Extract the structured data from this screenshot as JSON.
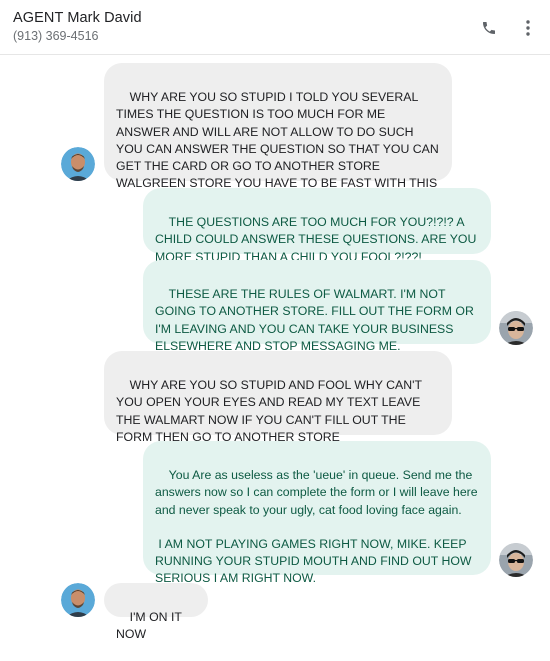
{
  "header": {
    "contact_name": "AGENT Mark David",
    "contact_phone": "(913) 369-4516"
  },
  "icons": {
    "call": "phone-icon",
    "more": "more-vert-icon"
  },
  "colors": {
    "incoming_bubble": "#eeeeee",
    "outgoing_bubble": "#e3f3ef",
    "outgoing_text": "#0d5a43",
    "incoming_text": "#202124"
  },
  "messages": [
    {
      "direction": "incoming",
      "text": "WHY ARE YOU SO STUPID I TOLD YOU SEVERAL TIMES THE QUESTION IS TOO MUCH FOR ME ANSWER AND WILL ARE NOT ALLOW TO DO SUCH YOU CAN ANSWER THE QUESTION SO THAT YOU CAN GET THE CARD OR GO TO ANOTHER STORE WALGREEN STORE YOU HAVE TO BE FAST WITH THIS"
    },
    {
      "direction": "outgoing",
      "text": "THE QUESTIONS ARE TOO MUCH FOR YOU?!?!? A CHILD COULD ANSWER THESE QUESTIONS. ARE YOU MORE STUPID THAN A CHILD YOU FOOL?!??!"
    },
    {
      "direction": "outgoing",
      "text": "THESE ARE THE RULES OF WALMART. I'M NOT GOING TO ANOTHER STORE. FILL OUT THE FORM OR I'M LEAVING AND YOU CAN TAKE YOUR BUSINESS ELSEWHERE AND STOP MESSAGING ME."
    },
    {
      "direction": "incoming",
      "text": "WHY ARE YOU SO STUPID AND FOOL WHY CAN'T YOU OPEN YOUR EYES AND READ MY TEXT LEAVE THE WALMART NOW IF YOU CAN'T FILL OUT THE FORM THEN GO TO ANOTHER STORE"
    },
    {
      "direction": "outgoing",
      "text": "You Are as useless as the 'ueue' in queue. Send me the answers now so I can complete the form or I will leave here and never speak to your ugly, cat food loving face again.\n\n I AM NOT PLAYING GAMES RIGHT NOW, MIKE. KEEP RUNNING YOUR STUPID MOUTH AND FIND OUT HOW SERIOUS I AM RIGHT NOW."
    },
    {
      "direction": "incoming",
      "text": "I'M ON IT NOW"
    }
  ]
}
